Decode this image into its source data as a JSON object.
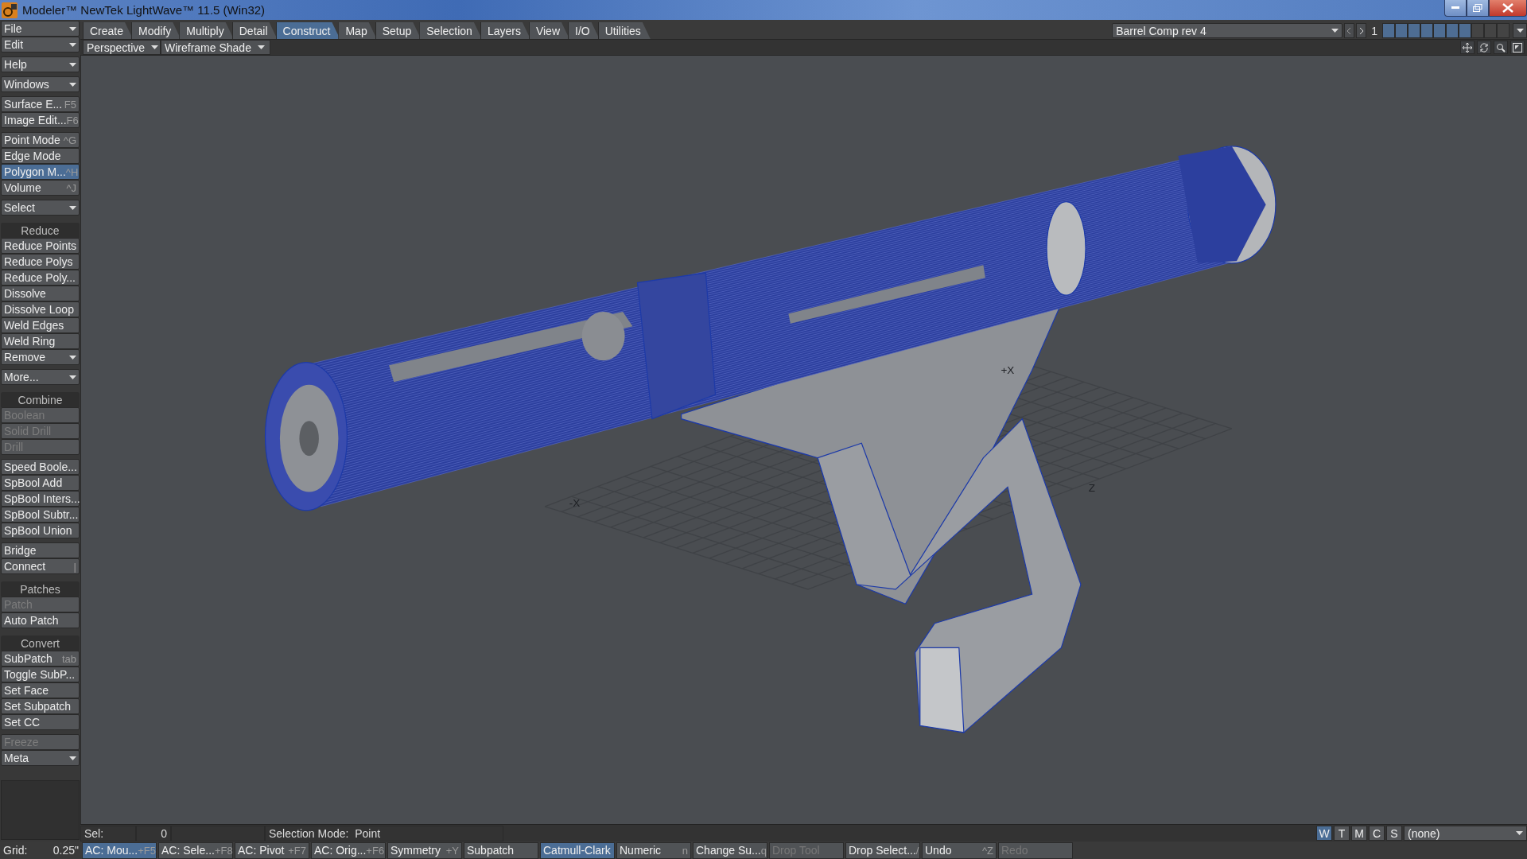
{
  "window": {
    "title": "Modeler™ NewTek LightWave™ 11.5 (Win32)"
  },
  "tabs": [
    {
      "label": "Create",
      "selected": false
    },
    {
      "label": "Modify",
      "selected": false
    },
    {
      "label": "Multiply",
      "selected": false
    },
    {
      "label": "Detail",
      "selected": false
    },
    {
      "label": "Construct",
      "selected": true
    },
    {
      "label": "Map",
      "selected": false
    },
    {
      "label": "Setup",
      "selected": false
    },
    {
      "label": "Selection",
      "selected": false
    },
    {
      "label": "Layers",
      "selected": false
    },
    {
      "label": "View",
      "selected": false
    },
    {
      "label": "I/O",
      "selected": false
    },
    {
      "label": "Utilities",
      "selected": false
    }
  ],
  "object_selector": {
    "value": "Barrel Comp rev 4",
    "layer_page": "1",
    "layers": [
      {
        "filled": true
      },
      {
        "filled": true
      },
      {
        "filled": true
      },
      {
        "filled": true
      },
      {
        "filled": true
      },
      {
        "filled": true
      },
      {
        "filled": true
      },
      {
        "filled": false
      },
      {
        "filled": false
      },
      {
        "filled": false
      }
    ]
  },
  "viewport": {
    "view": "Perspective",
    "shading": "Wireframe Shade",
    "axis_labels": [
      "+X",
      "-X",
      "Z"
    ]
  },
  "sidebar": [
    [
      {
        "kind": "menu",
        "label": "File"
      },
      {
        "kind": "menu",
        "label": "Edit"
      }
    ],
    [
      {
        "kind": "menu",
        "label": "Help"
      }
    ],
    [
      {
        "kind": "menu",
        "label": "Windows"
      }
    ],
    [
      {
        "kind": "button",
        "label": "Surface E...",
        "shortcut": "F5"
      },
      {
        "kind": "button",
        "label": "Image Edit...",
        "shortcut": "F6"
      }
    ],
    [
      {
        "kind": "button",
        "label": "Point Mode",
        "shortcut": "^G",
        "selected": false
      },
      {
        "kind": "button",
        "label": "Edge Mode",
        "selected": false
      },
      {
        "kind": "button",
        "label": "Polygon M...",
        "shortcut": "^H",
        "selected": true
      },
      {
        "kind": "button",
        "label": "Volume",
        "shortcut": "^J",
        "selected": false
      }
    ],
    [
      {
        "kind": "menu",
        "label": "Select"
      }
    ],
    [
      {
        "kind": "header",
        "label": "Reduce"
      },
      {
        "kind": "button",
        "label": "Reduce Points"
      },
      {
        "kind": "button",
        "label": "Reduce Polys"
      },
      {
        "kind": "button",
        "label": "Reduce Poly..."
      },
      {
        "kind": "button",
        "label": "Dissolve"
      },
      {
        "kind": "button",
        "label": "Dissolve Loop"
      },
      {
        "kind": "button",
        "label": "Weld Edges"
      },
      {
        "kind": "button",
        "label": "Weld Ring"
      },
      {
        "kind": "menu",
        "label": "Remove"
      }
    ],
    [
      {
        "kind": "menu",
        "label": "More..."
      }
    ],
    [
      {
        "kind": "header",
        "label": "Combine"
      },
      {
        "kind": "button",
        "label": "Boolean",
        "disabled": true
      },
      {
        "kind": "button",
        "label": "Solid Drill",
        "disabled": true
      },
      {
        "kind": "button",
        "label": "Drill",
        "disabled": true
      }
    ],
    [
      {
        "kind": "button",
        "label": "Speed Boole..."
      },
      {
        "kind": "button",
        "label": "SpBool Add"
      },
      {
        "kind": "button",
        "label": "SpBool Inters..."
      },
      {
        "kind": "button",
        "label": "SpBool Subtr..."
      },
      {
        "kind": "button",
        "label": "SpBool Union"
      }
    ],
    [
      {
        "kind": "button",
        "label": "Bridge"
      },
      {
        "kind": "button",
        "label": "Connect",
        "shortcut": "|"
      }
    ],
    [
      {
        "kind": "header",
        "label": "Patches"
      },
      {
        "kind": "button",
        "label": "Patch",
        "disabled": true
      },
      {
        "kind": "button",
        "label": "Auto Patch"
      }
    ],
    [
      {
        "kind": "header",
        "label": "Convert"
      },
      {
        "kind": "button",
        "label": "SubPatch",
        "shortcut": "tab"
      },
      {
        "kind": "button",
        "label": "Toggle SubP..."
      },
      {
        "kind": "button",
        "label": "Set Face"
      },
      {
        "kind": "button",
        "label": "Set Subpatch"
      },
      {
        "kind": "button",
        "label": "Set CC"
      }
    ],
    [
      {
        "kind": "button",
        "label": "Freeze",
        "disabled": true
      },
      {
        "kind": "menu",
        "label": "Meta"
      }
    ]
  ],
  "status_bar": {
    "sel_label": "Sel:",
    "sel_count": "0",
    "selection_mode": "Selection Mode:  Point",
    "view_toggles": [
      {
        "label": "W",
        "selected": true
      },
      {
        "label": "T",
        "selected": false
      },
      {
        "label": "M",
        "selected": false
      },
      {
        "label": "C",
        "selected": false
      },
      {
        "label": "S",
        "selected": false
      }
    ],
    "vmap": "(none)"
  },
  "bottom_bar": {
    "grid_label": "Grid:",
    "grid_value": "0.25\"",
    "buttons": [
      {
        "label": "AC: Mou...",
        "shortcut": "+F5",
        "selected": true,
        "disabled": false
      },
      {
        "label": "AC: Sele...",
        "shortcut": "+F8",
        "selected": false,
        "disabled": false
      },
      {
        "label": "AC: Pivot",
        "shortcut": "+F7",
        "selected": false,
        "disabled": false
      },
      {
        "label": "AC: Orig...",
        "shortcut": "+F6",
        "selected": false,
        "disabled": false
      },
      {
        "label": "Symmetry",
        "shortcut": "+Y",
        "selected": false,
        "disabled": false
      },
      {
        "label": "Subpatch",
        "selected": false,
        "disabled": false
      },
      {
        "label": "Catmull-Clark",
        "selected": true,
        "disabled": false
      },
      {
        "label": "Numeric",
        "shortcut": "n",
        "selected": false,
        "disabled": false
      },
      {
        "label": "Change Su...",
        "shortcut": "q",
        "selected": false,
        "disabled": false
      },
      {
        "label": "Drop Tool",
        "selected": false,
        "disabled": true
      },
      {
        "label": "Drop Select...",
        "shortcut": "/",
        "selected": false,
        "disabled": false
      },
      {
        "label": "Undo",
        "shortcut": "^Z",
        "selected": false,
        "disabled": false
      },
      {
        "label": "Redo",
        "selected": false,
        "disabled": true
      }
    ]
  }
}
